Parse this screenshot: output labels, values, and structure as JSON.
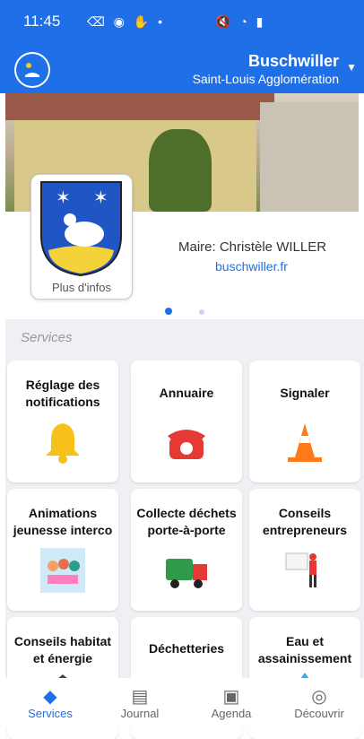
{
  "status": {
    "time": "11:45",
    "left_icons": "⌫ ◉ ✋ •",
    "right_icons": "🔇 ◔ ▮"
  },
  "header": {
    "town": "Buschwiller",
    "agglo": "Saint-Louis Agglomération",
    "caret": "▼"
  },
  "profile": {
    "more_info": "Plus d'infos",
    "mayor": "Maire: Christèle WILLER",
    "website": "buschwiller.fr"
  },
  "services": {
    "title": "Services",
    "cards": [
      {
        "title": "Réglage des notifications",
        "icon": "bell-icon"
      },
      {
        "title": "Annuaire",
        "icon": "phone-icon"
      },
      {
        "title": "Signaler",
        "icon": "traffic-cone-icon"
      },
      {
        "title": "Animations jeunesse interco",
        "icon": "kids-icon"
      },
      {
        "title": "Collecte déchets porte-à-porte",
        "icon": "garbage-truck-icon"
      },
      {
        "title": "Conseils entrepreneurs",
        "icon": "presentation-icon"
      },
      {
        "title": "Conseils habitat et énergie",
        "icon": "house-energy-icon"
      },
      {
        "title": "Déchetteries",
        "icon": "recycle-icon"
      },
      {
        "title": "Eau et assainissement",
        "icon": "water-icon"
      }
    ]
  },
  "tabs": [
    {
      "label": "Services",
      "icon": "services-icon",
      "glyph": "◆"
    },
    {
      "label": "Journal",
      "icon": "newspaper-icon",
      "glyph": "▤"
    },
    {
      "label": "Agenda",
      "icon": "calendar-icon",
      "glyph": "▣"
    },
    {
      "label": "Découvrir",
      "icon": "compass-icon",
      "glyph": "◎"
    }
  ],
  "colors": {
    "primary": "#1e6fe8",
    "card_bg": "#ffffff",
    "services_bg": "#eef0f3"
  }
}
